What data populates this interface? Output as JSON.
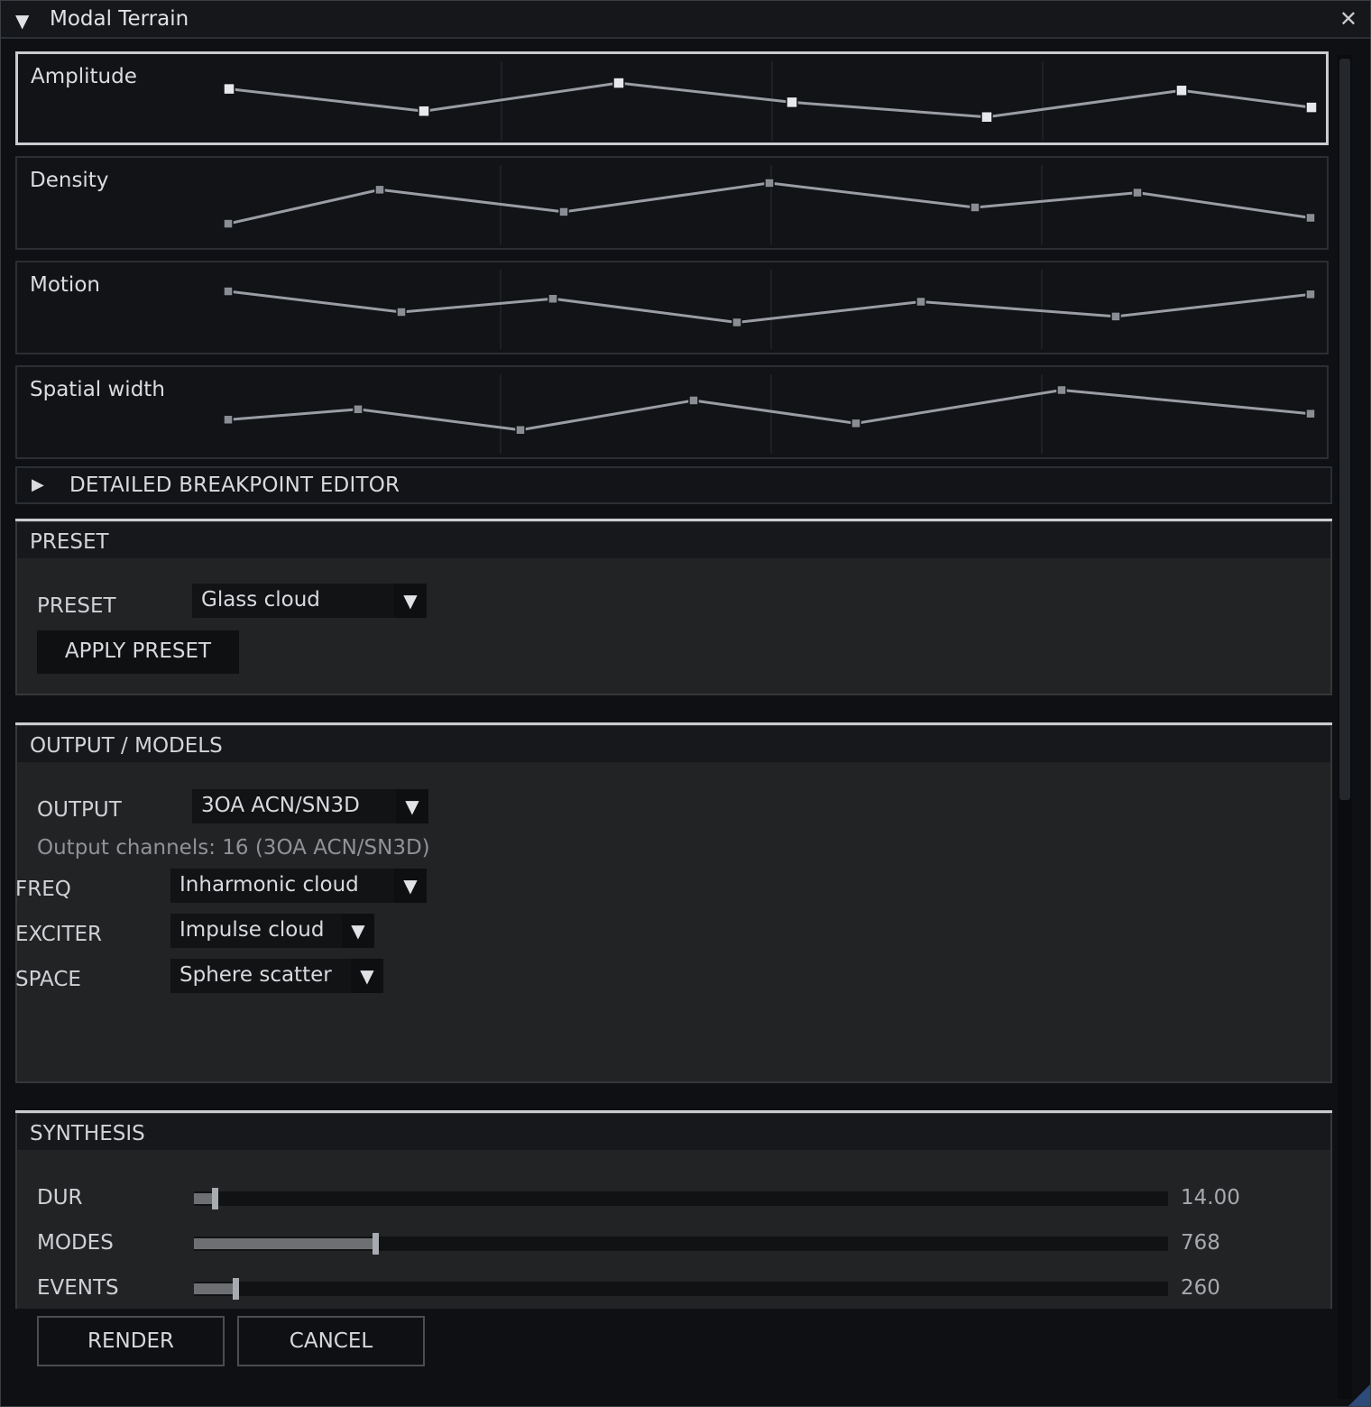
{
  "window": {
    "title": "Modal Terrain",
    "close_glyph": "✕"
  },
  "envelopes": [
    {
      "label": "Amplitude",
      "points": [
        [
          0.0,
          0.7
        ],
        [
          0.18,
          0.4
        ],
        [
          0.36,
          0.78
        ],
        [
          0.52,
          0.52
        ],
        [
          0.7,
          0.32
        ],
        [
          0.88,
          0.68
        ],
        [
          1.0,
          0.45
        ]
      ]
    },
    {
      "label": "Density",
      "points": [
        [
          0.0,
          0.28
        ],
        [
          0.14,
          0.74
        ],
        [
          0.31,
          0.44
        ],
        [
          0.5,
          0.83
        ],
        [
          0.69,
          0.5
        ],
        [
          0.84,
          0.7
        ],
        [
          1.0,
          0.36
        ]
      ]
    },
    {
      "label": "Motion",
      "points": [
        [
          0.0,
          0.78
        ],
        [
          0.16,
          0.5
        ],
        [
          0.3,
          0.68
        ],
        [
          0.47,
          0.36
        ],
        [
          0.64,
          0.64
        ],
        [
          0.82,
          0.44
        ],
        [
          1.0,
          0.74
        ]
      ]
    },
    {
      "label": "Spatial width",
      "points": [
        [
          0.0,
          0.46
        ],
        [
          0.12,
          0.6
        ],
        [
          0.27,
          0.32
        ],
        [
          0.43,
          0.72
        ],
        [
          0.58,
          0.41
        ],
        [
          0.77,
          0.86
        ],
        [
          1.0,
          0.54
        ]
      ]
    }
  ],
  "breakpoint_editor": {
    "label": "DETAILED BREAKPOINT EDITOR",
    "expanded": false
  },
  "preset": {
    "header": "PRESET",
    "label": "PRESET",
    "selected": "Glass cloud",
    "apply_label": "APPLY PRESET"
  },
  "output_models": {
    "header": "OUTPUT / MODELS",
    "output_label": "OUTPUT",
    "output_selected": "3OA ACN/SN3D",
    "channels_info": "Output channels: 16 (3OA ACN/SN3D)",
    "freq_label": "FREQ",
    "freq_selected": "Inharmonic cloud",
    "exciter_label": "EXCITER",
    "exciter_selected": "Impulse cloud",
    "space_label": "SPACE",
    "space_selected": "Sphere scatter"
  },
  "synthesis": {
    "header": "SYNTHESIS",
    "sliders": [
      {
        "label": "DUR",
        "value": "14.00",
        "fraction": 0.02
      },
      {
        "label": "MODES",
        "value": "768",
        "fraction": 0.185
      },
      {
        "label": "EVENTS",
        "value": "260",
        "fraction": 0.042
      }
    ]
  },
  "footer": {
    "render_label": "RENDER",
    "cancel_label": "CANCEL"
  },
  "colors": {
    "selected_border": "#c9cbd0",
    "line": "#9a9ea4",
    "accent_corner": "#2d4a78"
  },
  "icons": {
    "collapse": "triangle-down-icon",
    "expand": "triangle-right-icon",
    "close": "close-icon",
    "dropdown": "chevron-down-icon"
  }
}
